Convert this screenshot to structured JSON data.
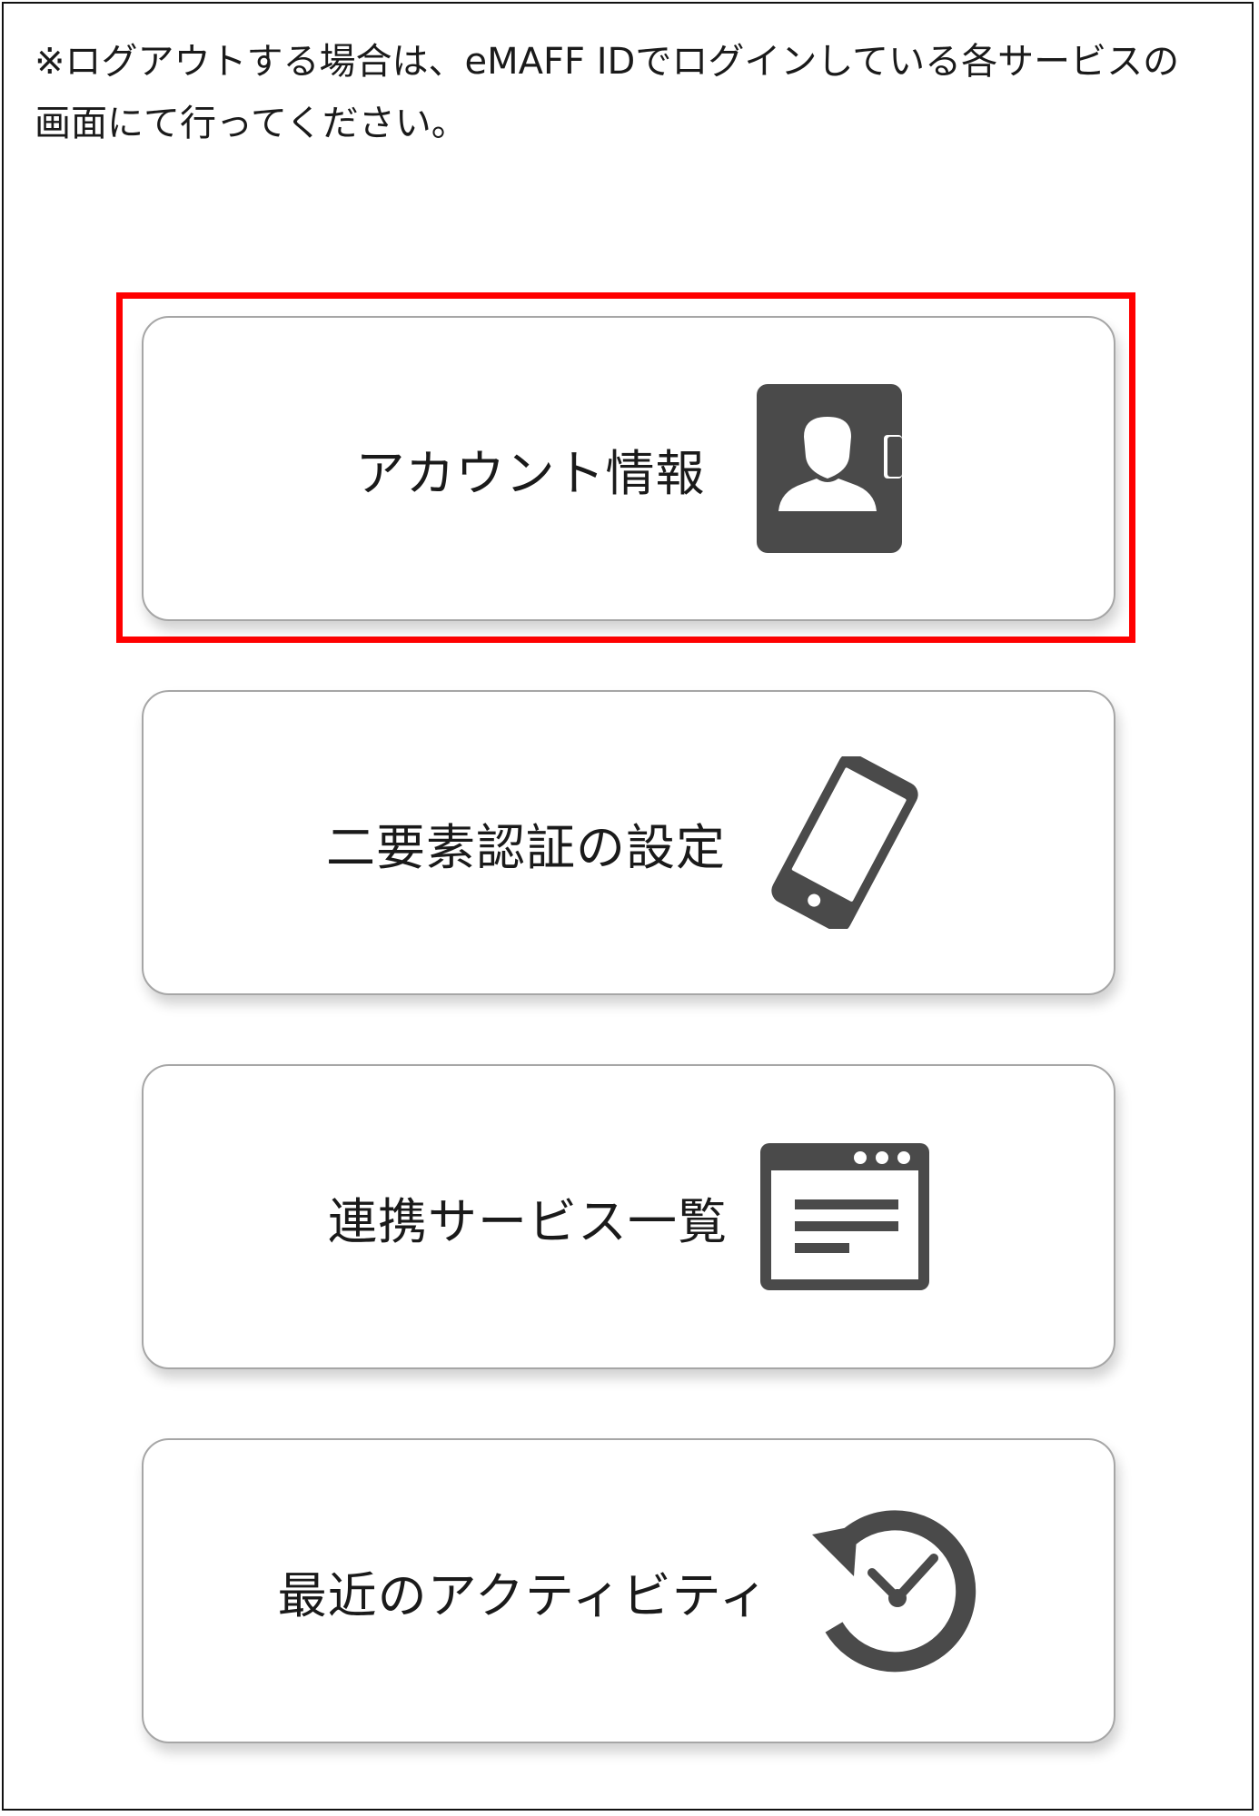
{
  "notice": {
    "text": "※ログアウトする場合は、eMAFF IDでログインしている各サービスの画面にて行ってください。"
  },
  "menu": {
    "items": [
      {
        "id": "account",
        "label": "アカウント情報",
        "icon": "account-card-icon"
      },
      {
        "id": "twofactor",
        "label": "二要素認証の設定",
        "icon": "smartphone-icon"
      },
      {
        "id": "services",
        "label": "連携サービス一覧",
        "icon": "browser-window-icon"
      },
      {
        "id": "activity",
        "label": "最近のアクティビティ",
        "icon": "clock-history-icon"
      }
    ],
    "highlighted": "account"
  },
  "colors": {
    "icon": "#4a4a4a",
    "highlight_border": "#ff0000",
    "card_border": "#a6a6a6"
  }
}
